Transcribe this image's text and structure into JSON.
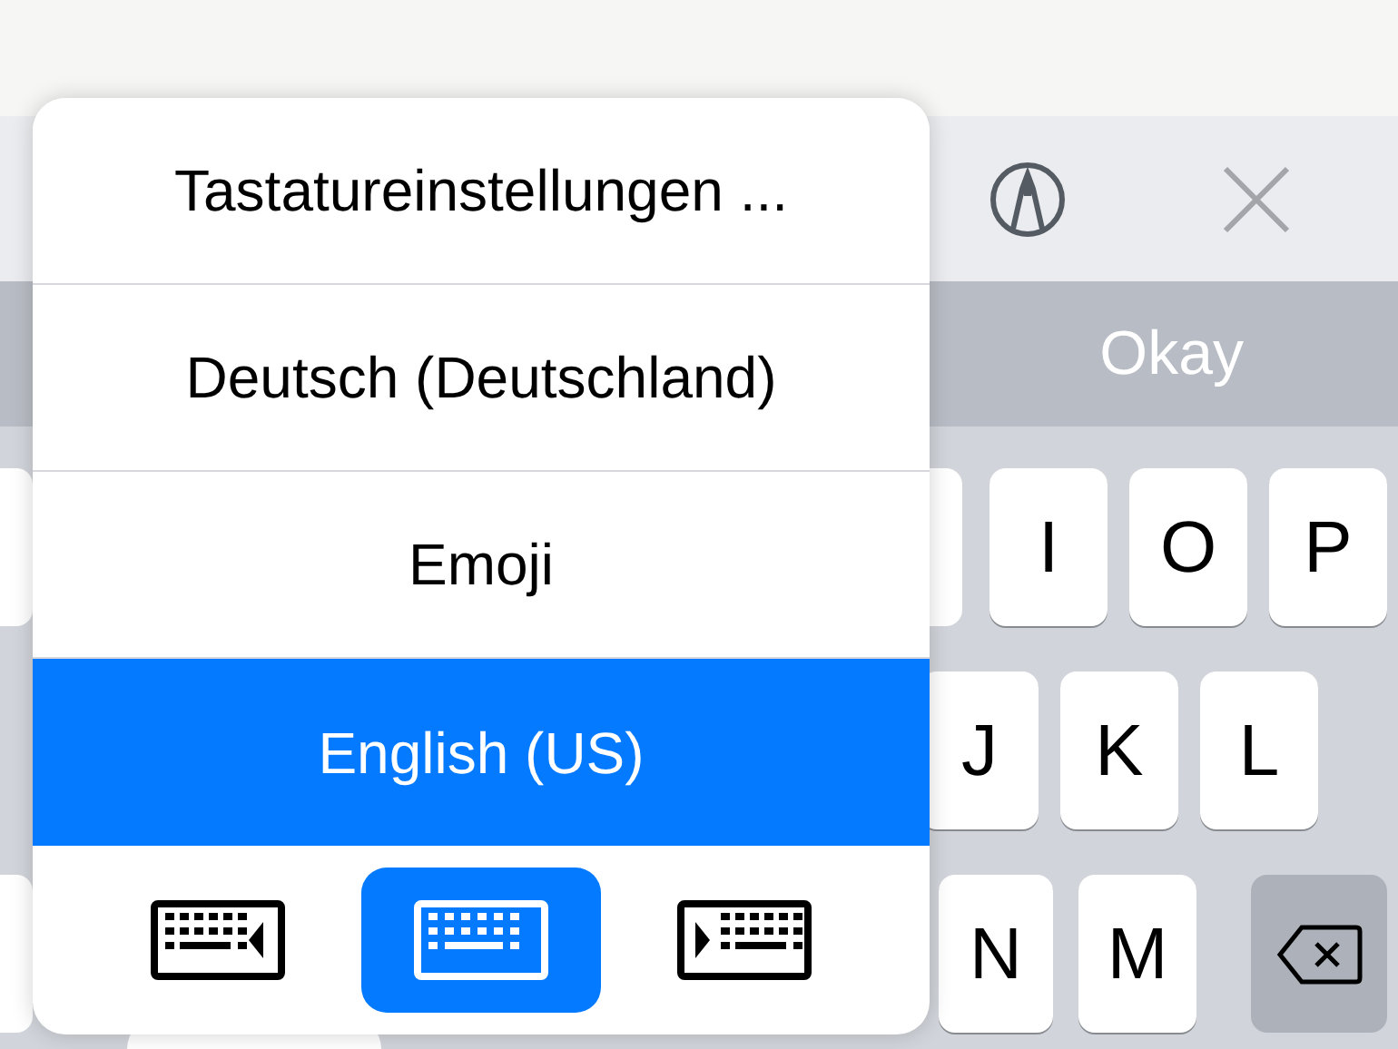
{
  "suggestion_bar": {
    "suggestions": [
      "Okay"
    ]
  },
  "keyboard": {
    "rows": [
      [
        "I",
        "O",
        "P"
      ],
      [
        "J",
        "K",
        "L"
      ],
      [
        "N",
        "M"
      ]
    ]
  },
  "language_menu": {
    "items": [
      {
        "label": "Tastatureinstellungen ...",
        "selected": false
      },
      {
        "label": "Deutsch (Deutschland)",
        "selected": false
      },
      {
        "label": "Emoji",
        "selected": false
      },
      {
        "label": "English (US)",
        "selected": true
      }
    ],
    "layout_options": [
      {
        "kind": "left",
        "selected": false
      },
      {
        "kind": "full",
        "selected": true
      },
      {
        "kind": "right",
        "selected": false
      }
    ]
  }
}
